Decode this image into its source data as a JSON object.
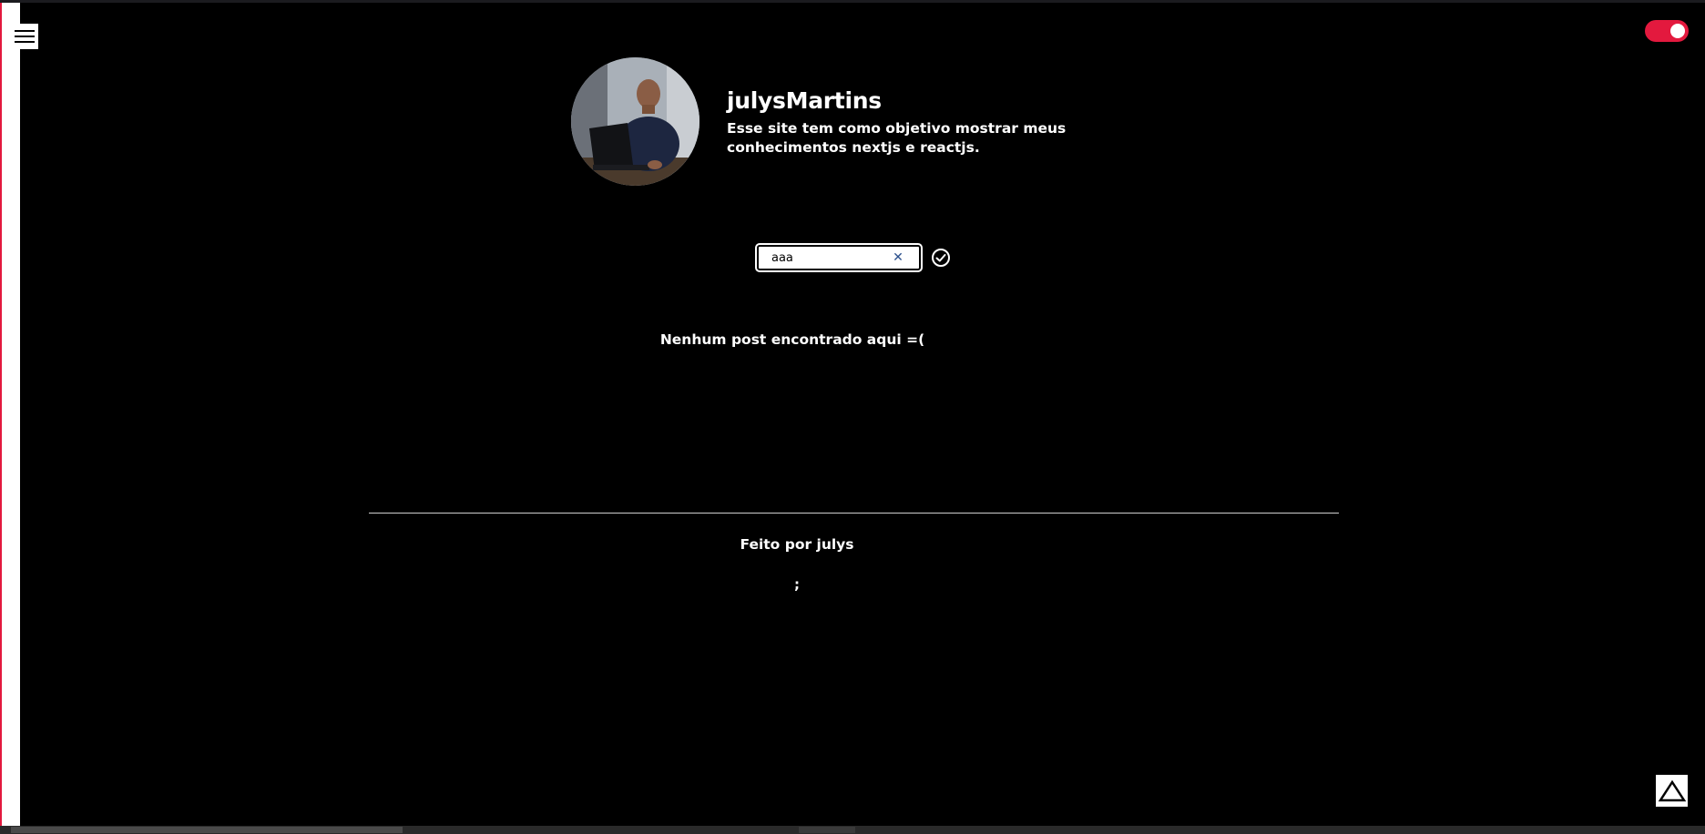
{
  "profile": {
    "name": "julysMartins",
    "description": "Esse site tem como objetivo mostrar meus conhecimentos nextjs e reactjs."
  },
  "search": {
    "value": "aaa",
    "placeholder": ""
  },
  "posts": {
    "empty_message": "Nenhum post encontrado aqui =("
  },
  "footer": {
    "credit": "Feito por julys",
    "extra": ";"
  },
  "theme": {
    "toggle_on": true,
    "accent": "#e3193e"
  },
  "icons": {
    "menu": "hamburger-menu-icon",
    "clear": "close-icon",
    "submit": "check-circle-icon",
    "scroll_top": "triangle-up-icon"
  }
}
